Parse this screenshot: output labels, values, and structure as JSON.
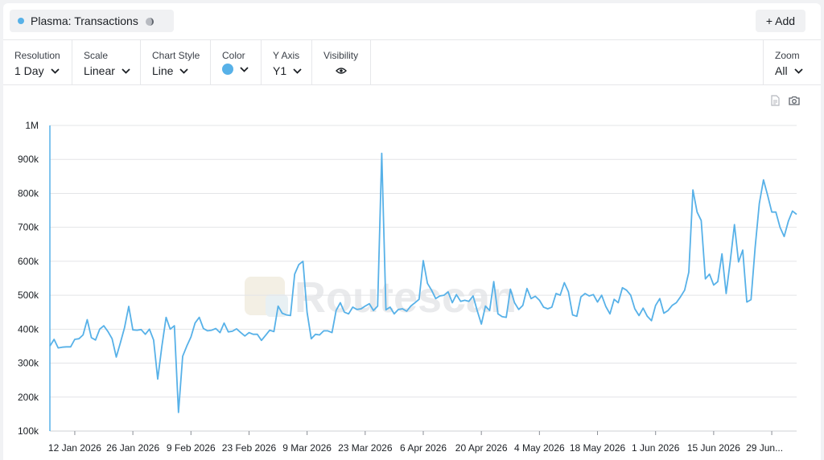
{
  "series_tag": {
    "label": "Plasma: Transactions",
    "icon": "spinner-icon"
  },
  "add_button": {
    "label": "+ Add"
  },
  "controls": {
    "resolution": {
      "label": "Resolution",
      "value": "1 Day"
    },
    "scale": {
      "label": "Scale",
      "value": "Linear"
    },
    "chart_style": {
      "label": "Chart Style",
      "value": "Line"
    },
    "color": {
      "label": "Color",
      "value": "#57b1e8"
    },
    "y_axis": {
      "label": "Y Axis",
      "value": "Y1"
    },
    "visibility": {
      "label": "Visibility",
      "icon": "eye-icon"
    },
    "zoom": {
      "label": "Zoom",
      "value": "All"
    }
  },
  "toolbar": {
    "icons": [
      "document-icon",
      "camera-icon"
    ]
  },
  "watermark": "Routescan",
  "colors": {
    "line": "#57b1e8",
    "grid": "#e3e4e7",
    "accent": "#57b1e8"
  },
  "chart_data": {
    "type": "line",
    "title": "",
    "xlabel": "",
    "ylabel": "",
    "ylim": [
      100000,
      1000000
    ],
    "y_ticks": [
      100000,
      200000,
      300000,
      400000,
      500000,
      600000,
      700000,
      800000,
      900000,
      1000000
    ],
    "y_tick_labels": [
      "100k",
      "200k",
      "300k",
      "400k",
      "500k",
      "600k",
      "700k",
      "800k",
      "900k",
      "1M"
    ],
    "x_range": [
      "2026-01-06",
      "2026-07-05"
    ],
    "x_ticks": [
      "2026-01-12",
      "2026-01-26",
      "2026-02-09",
      "2026-02-23",
      "2026-03-09",
      "2026-03-23",
      "2026-04-06",
      "2026-04-20",
      "2026-05-04",
      "2026-05-18",
      "2026-06-01",
      "2026-06-15",
      "2026-06-29"
    ],
    "x_tick_labels": [
      "12 Jan 2026",
      "26 Jan 2026",
      "9 Feb 2026",
      "23 Feb 2026",
      "9 Mar 2026",
      "23 Mar 2026",
      "6 Apr 2026",
      "20 Apr 2026",
      "4 May 2026",
      "18 May 2026",
      "1 Jun 2026",
      "15 Jun 2026",
      "29 Jun..."
    ],
    "grid": true,
    "legend": "none",
    "series": [
      {
        "color": "#57b1e8",
        "points": [
          [
            "2026-01-06",
            350000
          ],
          [
            "2026-01-07",
            370000
          ],
          [
            "2026-01-08",
            345000
          ],
          [
            "2026-01-09",
            347000
          ],
          [
            "2026-01-10",
            348000
          ],
          [
            "2026-01-11",
            348000
          ],
          [
            "2026-01-12",
            370000
          ],
          [
            "2026-01-13",
            372000
          ],
          [
            "2026-01-14",
            383000
          ],
          [
            "2026-01-15",
            428000
          ],
          [
            "2026-01-16",
            375000
          ],
          [
            "2026-01-17",
            368000
          ],
          [
            "2026-01-18",
            400000
          ],
          [
            "2026-01-19",
            410000
          ],
          [
            "2026-01-20",
            393000
          ],
          [
            "2026-01-21",
            372000
          ],
          [
            "2026-01-22",
            318000
          ],
          [
            "2026-01-23",
            360000
          ],
          [
            "2026-01-24",
            405000
          ],
          [
            "2026-01-25",
            467000
          ],
          [
            "2026-01-26",
            398000
          ],
          [
            "2026-01-27",
            397000
          ],
          [
            "2026-01-28",
            399000
          ],
          [
            "2026-01-29",
            385000
          ],
          [
            "2026-01-30",
            400000
          ],
          [
            "2026-01-31",
            368000
          ],
          [
            "2026-02-01",
            253000
          ],
          [
            "2026-02-02",
            350000
          ],
          [
            "2026-02-03",
            435000
          ],
          [
            "2026-02-04",
            400000
          ],
          [
            "2026-02-05",
            410000
          ],
          [
            "2026-02-06",
            155000
          ],
          [
            "2026-02-07",
            320000
          ],
          [
            "2026-02-08",
            350000
          ],
          [
            "2026-02-09",
            377000
          ],
          [
            "2026-02-10",
            418000
          ],
          [
            "2026-02-11",
            435000
          ],
          [
            "2026-02-12",
            402000
          ],
          [
            "2026-02-13",
            395000
          ],
          [
            "2026-02-14",
            397000
          ],
          [
            "2026-02-15",
            402000
          ],
          [
            "2026-02-16",
            390000
          ],
          [
            "2026-02-17",
            418000
          ],
          [
            "2026-02-18",
            392000
          ],
          [
            "2026-02-19",
            394000
          ],
          [
            "2026-02-20",
            401000
          ],
          [
            "2026-02-21",
            390000
          ],
          [
            "2026-02-22",
            380000
          ],
          [
            "2026-02-23",
            390000
          ],
          [
            "2026-02-24",
            385000
          ],
          [
            "2026-02-25",
            385000
          ],
          [
            "2026-02-26",
            367000
          ],
          [
            "2026-02-27",
            382000
          ],
          [
            "2026-02-28",
            397000
          ],
          [
            "2026-03-01",
            393000
          ],
          [
            "2026-03-02",
            468000
          ],
          [
            "2026-03-03",
            447000
          ],
          [
            "2026-03-04",
            442000
          ],
          [
            "2026-03-05",
            440000
          ],
          [
            "2026-03-06",
            562000
          ],
          [
            "2026-03-07",
            590000
          ],
          [
            "2026-03-08",
            600000
          ],
          [
            "2026-03-09",
            450000
          ],
          [
            "2026-03-10",
            372000
          ],
          [
            "2026-03-11",
            385000
          ],
          [
            "2026-03-12",
            383000
          ],
          [
            "2026-03-13",
            395000
          ],
          [
            "2026-03-14",
            395000
          ],
          [
            "2026-03-15",
            390000
          ],
          [
            "2026-03-16",
            455000
          ],
          [
            "2026-03-17",
            478000
          ],
          [
            "2026-03-18",
            450000
          ],
          [
            "2026-03-19",
            445000
          ],
          [
            "2026-03-20",
            465000
          ],
          [
            "2026-03-21",
            458000
          ],
          [
            "2026-03-22",
            460000
          ],
          [
            "2026-03-23",
            468000
          ],
          [
            "2026-03-24",
            475000
          ],
          [
            "2026-03-25",
            455000
          ],
          [
            "2026-03-26",
            468000
          ],
          [
            "2026-03-27",
            918000
          ],
          [
            "2026-03-28",
            457000
          ],
          [
            "2026-03-29",
            465000
          ],
          [
            "2026-03-30",
            445000
          ],
          [
            "2026-03-31",
            458000
          ],
          [
            "2026-04-01",
            460000
          ],
          [
            "2026-04-02",
            453000
          ],
          [
            "2026-04-03",
            468000
          ],
          [
            "2026-04-04",
            478000
          ],
          [
            "2026-04-05",
            488000
          ],
          [
            "2026-04-06",
            602000
          ],
          [
            "2026-04-07",
            535000
          ],
          [
            "2026-04-08",
            515000
          ],
          [
            "2026-04-09",
            490000
          ],
          [
            "2026-04-10",
            498000
          ],
          [
            "2026-04-11",
            500000
          ],
          [
            "2026-04-12",
            510000
          ],
          [
            "2026-04-13",
            478000
          ],
          [
            "2026-04-14",
            502000
          ],
          [
            "2026-04-15",
            482000
          ],
          [
            "2026-04-16",
            485000
          ],
          [
            "2026-04-17",
            482000
          ],
          [
            "2026-04-18",
            498000
          ],
          [
            "2026-04-19",
            455000
          ],
          [
            "2026-04-20",
            415000
          ],
          [
            "2026-04-21",
            468000
          ],
          [
            "2026-04-22",
            455000
          ],
          [
            "2026-04-23",
            540000
          ],
          [
            "2026-04-24",
            445000
          ],
          [
            "2026-04-25",
            437000
          ],
          [
            "2026-04-26",
            435000
          ],
          [
            "2026-04-27",
            518000
          ],
          [
            "2026-04-28",
            478000
          ],
          [
            "2026-04-29",
            458000
          ],
          [
            "2026-04-30",
            470000
          ],
          [
            "2026-05-01",
            520000
          ],
          [
            "2026-05-02",
            490000
          ],
          [
            "2026-05-03",
            497000
          ],
          [
            "2026-05-04",
            485000
          ],
          [
            "2026-05-05",
            465000
          ],
          [
            "2026-05-06",
            460000
          ],
          [
            "2026-05-07",
            465000
          ],
          [
            "2026-05-08",
            505000
          ],
          [
            "2026-05-09",
            500000
          ],
          [
            "2026-05-10",
            537000
          ],
          [
            "2026-05-11",
            510000
          ],
          [
            "2026-05-12",
            442000
          ],
          [
            "2026-05-13",
            438000
          ],
          [
            "2026-05-14",
            495000
          ],
          [
            "2026-05-15",
            505000
          ],
          [
            "2026-05-16",
            498000
          ],
          [
            "2026-05-17",
            502000
          ],
          [
            "2026-05-18",
            480000
          ],
          [
            "2026-05-19",
            500000
          ],
          [
            "2026-05-20",
            467000
          ],
          [
            "2026-05-21",
            445000
          ],
          [
            "2026-05-22",
            488000
          ],
          [
            "2026-05-23",
            478000
          ],
          [
            "2026-05-24",
            522000
          ],
          [
            "2026-05-25",
            515000
          ],
          [
            "2026-05-26",
            500000
          ],
          [
            "2026-05-27",
            460000
          ],
          [
            "2026-05-28",
            440000
          ],
          [
            "2026-05-29",
            462000
          ],
          [
            "2026-05-30",
            438000
          ],
          [
            "2026-05-31",
            425000
          ],
          [
            "2026-06-01",
            470000
          ],
          [
            "2026-06-02",
            490000
          ],
          [
            "2026-06-03",
            447000
          ],
          [
            "2026-06-04",
            455000
          ],
          [
            "2026-06-05",
            470000
          ],
          [
            "2026-06-06",
            478000
          ],
          [
            "2026-06-07",
            495000
          ],
          [
            "2026-06-08",
            515000
          ],
          [
            "2026-06-09",
            568000
          ],
          [
            "2026-06-10",
            810000
          ],
          [
            "2026-06-11",
            745000
          ],
          [
            "2026-06-12",
            720000
          ],
          [
            "2026-06-13",
            548000
          ],
          [
            "2026-06-14",
            562000
          ],
          [
            "2026-06-15",
            530000
          ],
          [
            "2026-06-16",
            540000
          ],
          [
            "2026-06-17",
            622000
          ],
          [
            "2026-06-18",
            505000
          ],
          [
            "2026-06-19",
            600000
          ],
          [
            "2026-06-20",
            708000
          ],
          [
            "2026-06-21",
            598000
          ],
          [
            "2026-06-22",
            633000
          ],
          [
            "2026-06-23",
            480000
          ],
          [
            "2026-06-24",
            487000
          ],
          [
            "2026-06-25",
            640000
          ],
          [
            "2026-06-26",
            770000
          ],
          [
            "2026-06-27",
            840000
          ],
          [
            "2026-06-28",
            795000
          ],
          [
            "2026-06-29",
            745000
          ],
          [
            "2026-06-30",
            745000
          ],
          [
            "2026-07-01",
            700000
          ],
          [
            "2026-07-02",
            673000
          ],
          [
            "2026-07-03",
            718000
          ],
          [
            "2026-07-04",
            748000
          ],
          [
            "2026-07-05",
            738000
          ]
        ]
      }
    ]
  }
}
